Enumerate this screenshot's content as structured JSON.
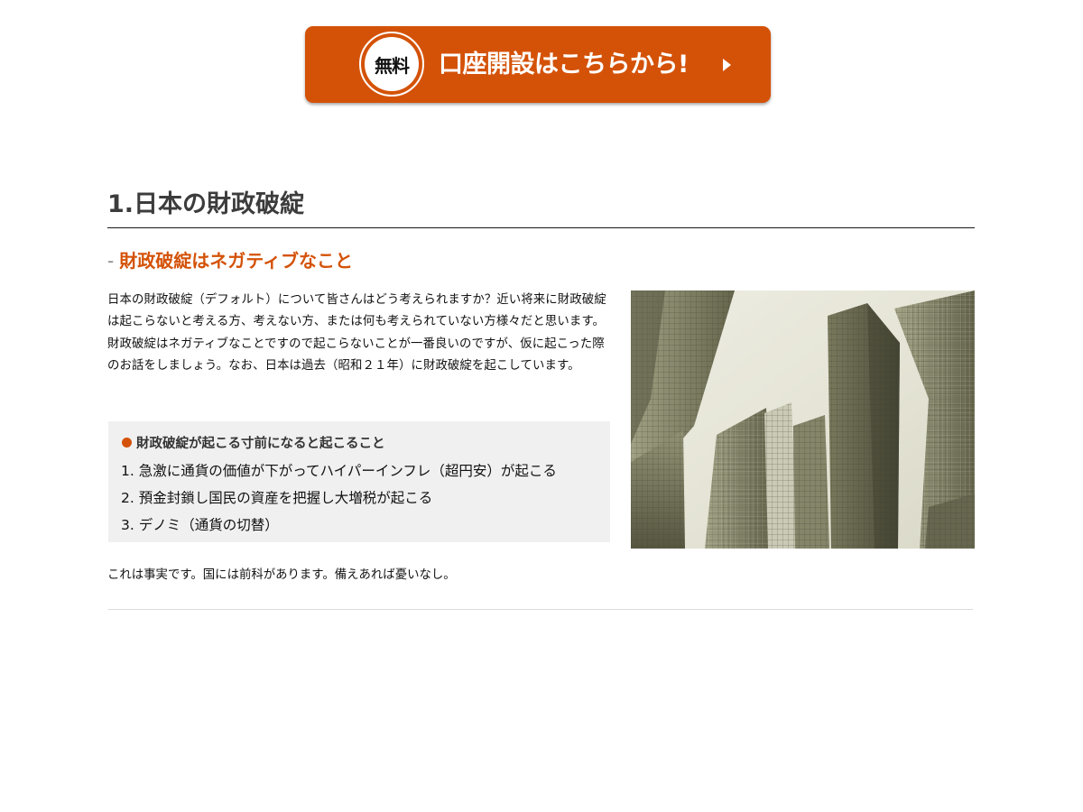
{
  "cta": {
    "badge": "無料",
    "label": "口座開設はこちらから!",
    "color": "#d45208",
    "arrow_icon": "play-triangle-icon"
  },
  "section": {
    "title": "1.日本の財政破綻",
    "subtitle_prefix": "-",
    "subtitle": "財政破綻はネガティブなこと",
    "intro": "日本の財政破綻（デフォルト）について皆さんはどう考えられますか？近い将来に財政破綻は起こらないと考える方、考えない方、または何も考えられていない方様々だと思います。財政破綻はネガティブなことですので起こらないことが一番良いのですが、仮に起こった際のお話をしましょう。なお、日本は過去（昭和２１年）に財政破綻を起こしています。",
    "points": {
      "title": "財政破綻が起こる寸前になると起こること",
      "items": [
        "1. 急激に通貨の価値が下がってハイパーインフレ（超円安）が起こる",
        "2. 預金封鎖し国民の資産を把握し大増税が起こる",
        "3. デノミ（通貨の切替）"
      ]
    },
    "closing": "これは事実です。国には前科があります。備えあれば憂いなし。",
    "photo_icon": "skyscrapers-photo"
  }
}
